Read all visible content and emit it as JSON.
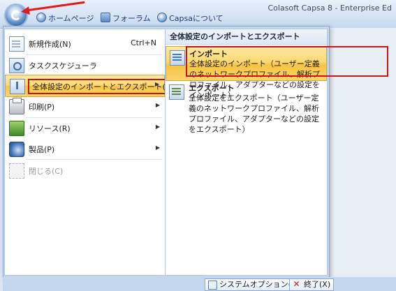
{
  "window": {
    "app_title": "Colasoft Capsa 8 - Enterprise Ed",
    "tabs": [
      {
        "label": "ホームページ"
      },
      {
        "label": "フォーラム"
      },
      {
        "label": "Capsaについて"
      }
    ]
  },
  "menu": {
    "items": [
      {
        "label": "新規作成(N)",
        "shortcut": "Ctrl+N",
        "icon": "new-document-icon"
      },
      {
        "label": "タスクスケジューラ",
        "icon": "task-scheduler-icon"
      },
      {
        "label": "全体設定のインポートとエクスポート(E)",
        "icon": "import-export-icon",
        "submenu": true
      },
      {
        "label": "印刷(P)",
        "icon": "printer-icon",
        "submenu": true
      },
      {
        "label": "リソース(R)",
        "icon": "books-icon",
        "submenu": true
      },
      {
        "label": "製品(P)",
        "icon": "product-icon",
        "submenu": true
      },
      {
        "label": "閉じる(C)",
        "icon": "close-file-icon",
        "disabled": true
      }
    ]
  },
  "submenu": {
    "title": "全体設定のインポートとエクスポート",
    "items": [
      {
        "title": "インポート",
        "desc": "全体設定のインポート（ユーザー定義のネットワークプロファイル、解析プロファイル、アダプターなどの設定をインポート）",
        "icon": "import-icon"
      },
      {
        "title": "エクスポート",
        "desc": "全体設定をエクスポート（ユーザー定義のネットワークプロファイル、解析プロファイル、アダプターなどの設定をエクスポート）",
        "icon": "export-icon"
      }
    ]
  },
  "footer": {
    "options_label": "システムオプション(O)",
    "exit_label": "終了(X)"
  },
  "colors": {
    "highlight": "#fbd872",
    "annotation_red": "#c81414"
  }
}
